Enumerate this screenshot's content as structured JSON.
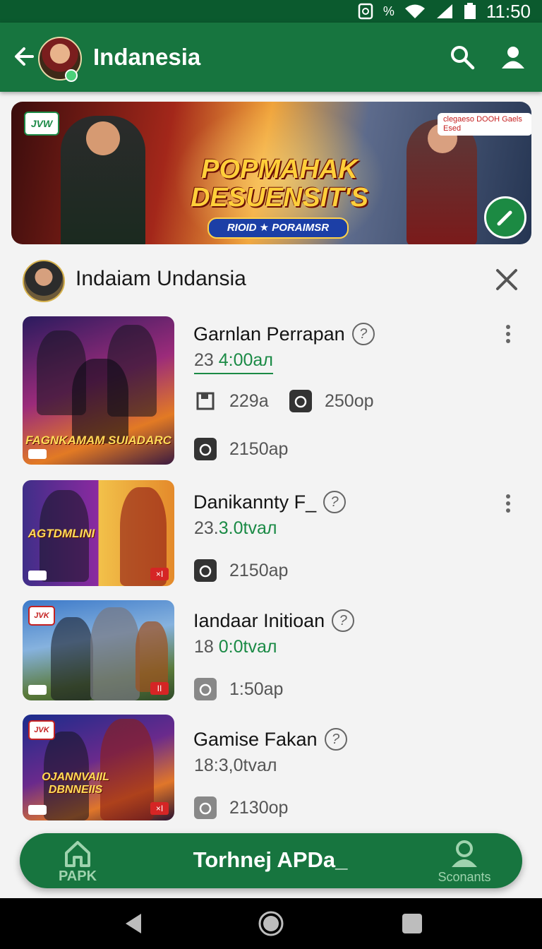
{
  "status_bar": {
    "time": "11:50",
    "battery_label": "%"
  },
  "app_bar": {
    "title": "Indanesia"
  },
  "banner": {
    "logo_text": "JVW",
    "title_line1": "POPMAHAK",
    "title_line2": "DESUENSIT'S",
    "subtitle": "RIOID ★ PORAIMSR",
    "badge_text": "clegaeso DOOH Gaels Esed"
  },
  "section": {
    "title": "Indaiam Undansia"
  },
  "games": [
    {
      "name": "Garnlan Perrapan",
      "sub_prefix": "23",
      "sub_value": "4:00aл",
      "thumb_label": "FAGNKAMAM SUIADARC",
      "stats": [
        {
          "icon": "save-icon",
          "value": "229a"
        },
        {
          "icon": "camera-icon",
          "value": "250op"
        },
        {
          "icon": "camera-icon",
          "value": "2150ap"
        }
      ]
    },
    {
      "name": "Danikannty F_",
      "sub_prefix": "23.",
      "sub_value": "3.0tvaл",
      "thumb_label": "AGTDMLINI",
      "stats": [
        {
          "icon": "camera-icon",
          "value": "2150ap"
        }
      ]
    },
    {
      "name": "Iandaar Initioan",
      "sub_prefix": "18",
      "sub_value": "0:0tvaл",
      "thumb_label": "",
      "stats": [
        {
          "icon": "camera-icon",
          "value": "1:50ap"
        }
      ]
    },
    {
      "name": "Gamise Fakan",
      "sub_prefix": "18:3,0",
      "sub_value": "tvaл",
      "thumb_label": "OJANNVAIIL DBNNEIIS",
      "stats": [
        {
          "icon": "camera-icon",
          "value": "2130op"
        }
      ]
    }
  ],
  "bottom_bar": {
    "home_label": "PAPK",
    "center_label": "Torhnej APDa_",
    "contacts_label": "Sconants"
  },
  "colors": {
    "primary": "#17753f",
    "status": "#0b5a2e",
    "accent": "#1a8a45"
  }
}
